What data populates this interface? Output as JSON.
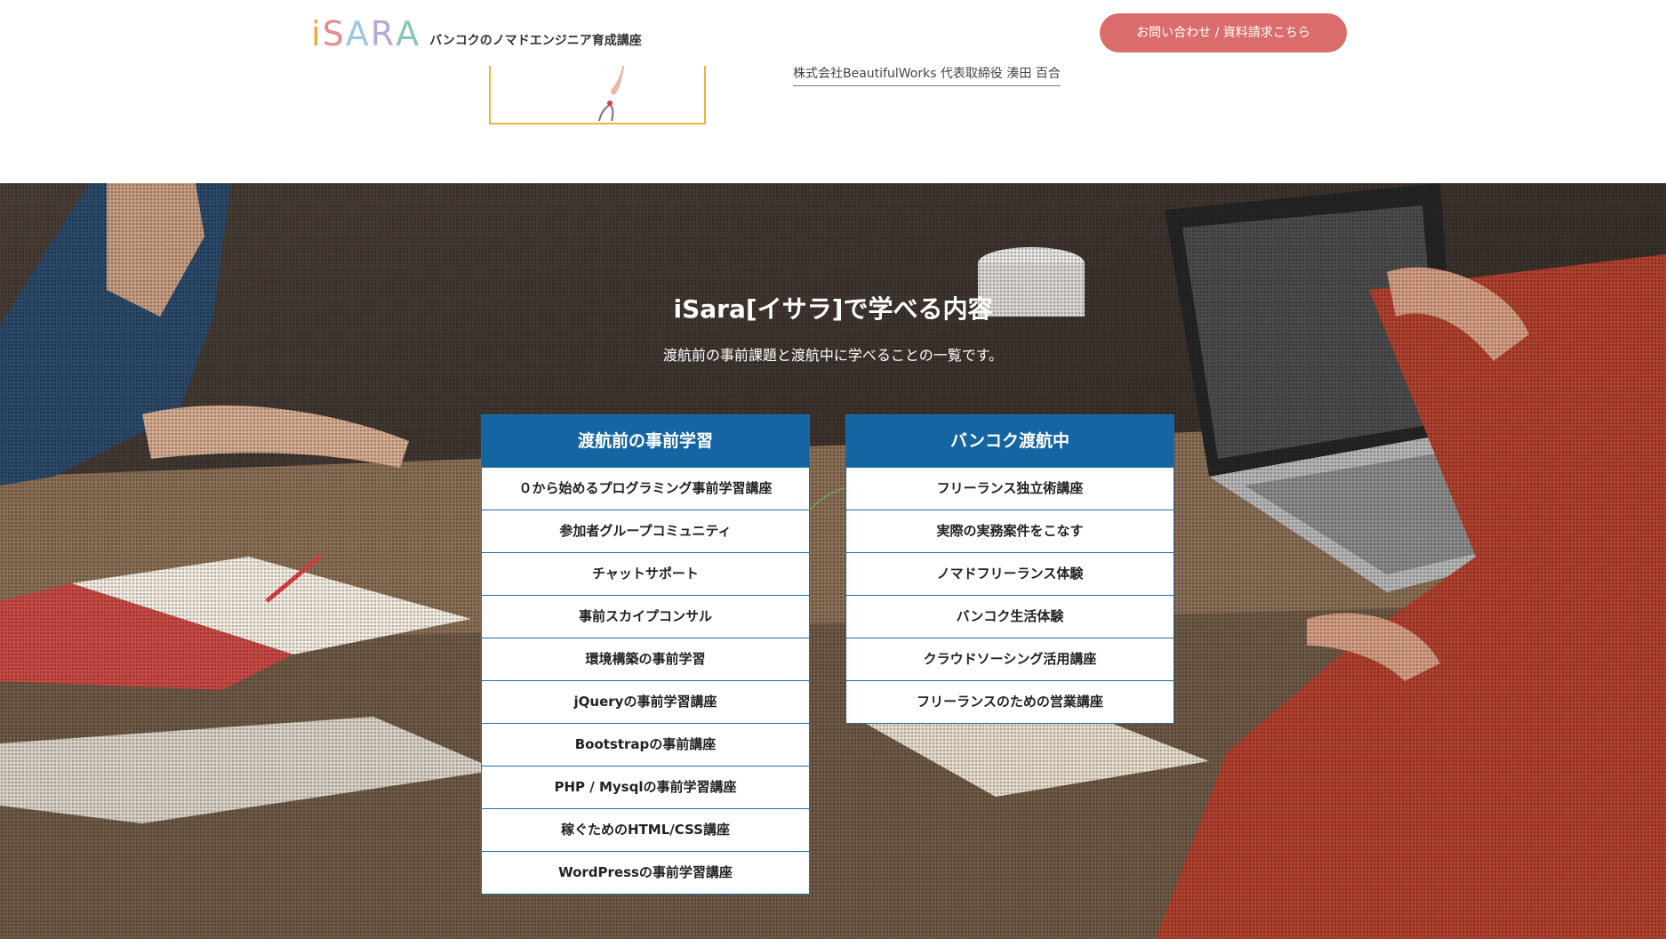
{
  "header": {
    "logo_text": "iSARA",
    "tagline": "バンコクのノマドエンジニア育成講座",
    "cta_label": "お問い合わせ / 資料請求こちら"
  },
  "testimonial": {
    "author": "株式会社BeautifulWorks 代表取締役 湊田 百合"
  },
  "hero": {
    "title": "iSara[イサラ]で学べる内容",
    "subtitle": "渡航前の事前課題と渡航中に学べることの一覧です。",
    "columns": [
      {
        "heading": "渡航前の事前学習",
        "items": [
          "０から始めるプログラミング事前学習講座",
          "参加者グループコミュニティ",
          "チャットサポート",
          "事前スカイプコンサル",
          "環境構築の事前学習",
          "jQueryの事前学習講座",
          "Bootstrapの事前講座",
          "PHP / Mysqlの事前学習講座",
          "稼ぐためのHTML/CSS講座",
          "WordPressの事前学習講座"
        ]
      },
      {
        "heading": "バンコク渡航中",
        "items": [
          "フリーランス独立術講座",
          "実際の実務案件をこなす",
          "ノマドフリーランス体験",
          "バンコク生活体験",
          "クラウドソーシング活用講座",
          "フリーランスのための営業講座"
        ]
      }
    ]
  },
  "colors": {
    "cta": "#db6c6c",
    "column_header": "#1565a2",
    "frame_accent": "#f1b13c"
  }
}
